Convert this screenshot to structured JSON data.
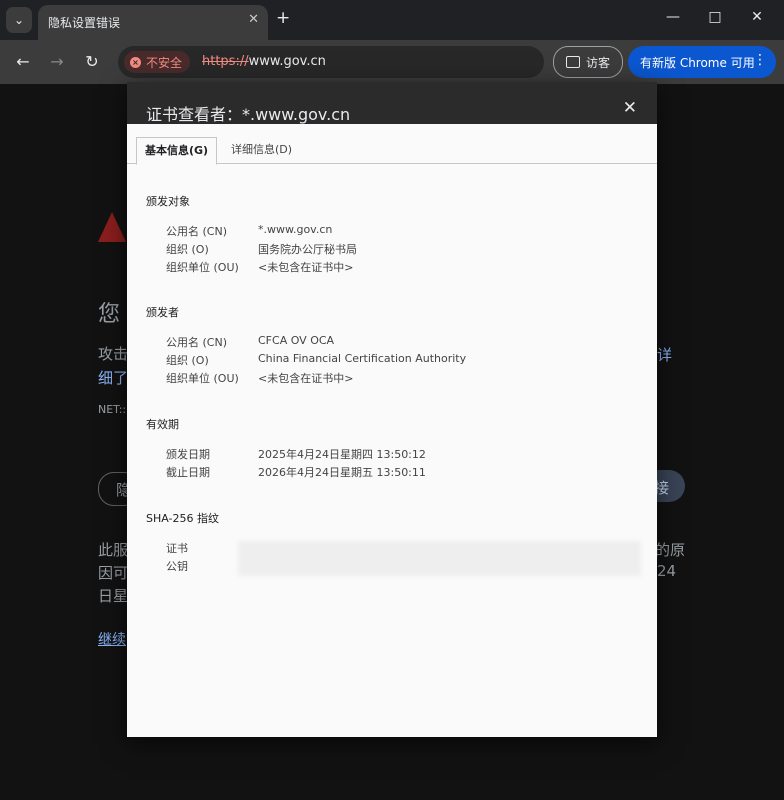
{
  "browser": {
    "tab_title": "隐私设置错误",
    "security_chip": "不安全",
    "url_scheme": "https://",
    "url_host": "www.gov.cn",
    "guest_label": "访客",
    "update_label": "有新版 Chrome 可用"
  },
  "background_page": {
    "heading_fragment": "您",
    "line1_start": "攻击",
    "line1_end": "详",
    "line2_start": "细了",
    "net_error": "NET::",
    "button_left": "隐",
    "button_right": "接",
    "text2_line1_start": "此服",
    "text2_line1_end": "的原",
    "text2_line2_start": "因可",
    "text2_line2_end": "24",
    "text2_line3_start": "日星",
    "continue_link": "继续"
  },
  "dialog": {
    "title": "证书查看者：*.www.gov.cn",
    "tabs": [
      {
        "label": "基本信息(G)"
      },
      {
        "label": "详细信息(D)"
      }
    ],
    "sections": {
      "issued_to": {
        "title": "颁发对象",
        "rows": [
          {
            "label": "公用名 (CN)",
            "value": "*.www.gov.cn"
          },
          {
            "label": "组织 (O)",
            "value": "国务院办公厅秘书局"
          },
          {
            "label": "组织单位 (OU)",
            "value": "<未包含在证书中>"
          }
        ]
      },
      "issued_by": {
        "title": "颁发者",
        "rows": [
          {
            "label": "公用名 (CN)",
            "value": "CFCA OV OCA"
          },
          {
            "label": "组织 (O)",
            "value": "China Financial Certification Authority"
          },
          {
            "label": "组织单位 (OU)",
            "value": "<未包含在证书中>"
          }
        ]
      },
      "validity": {
        "title": "有效期",
        "rows": [
          {
            "label": "颁发日期",
            "value": "2025年4月24日星期四 13:50:12"
          },
          {
            "label": "截止日期",
            "value": "2026年4月24日星期五 13:50:11"
          }
        ]
      },
      "fingerprints": {
        "title": "SHA-256 指纹",
        "rows": [
          {
            "label": "证书"
          },
          {
            "label": "公钥"
          }
        ]
      }
    }
  }
}
